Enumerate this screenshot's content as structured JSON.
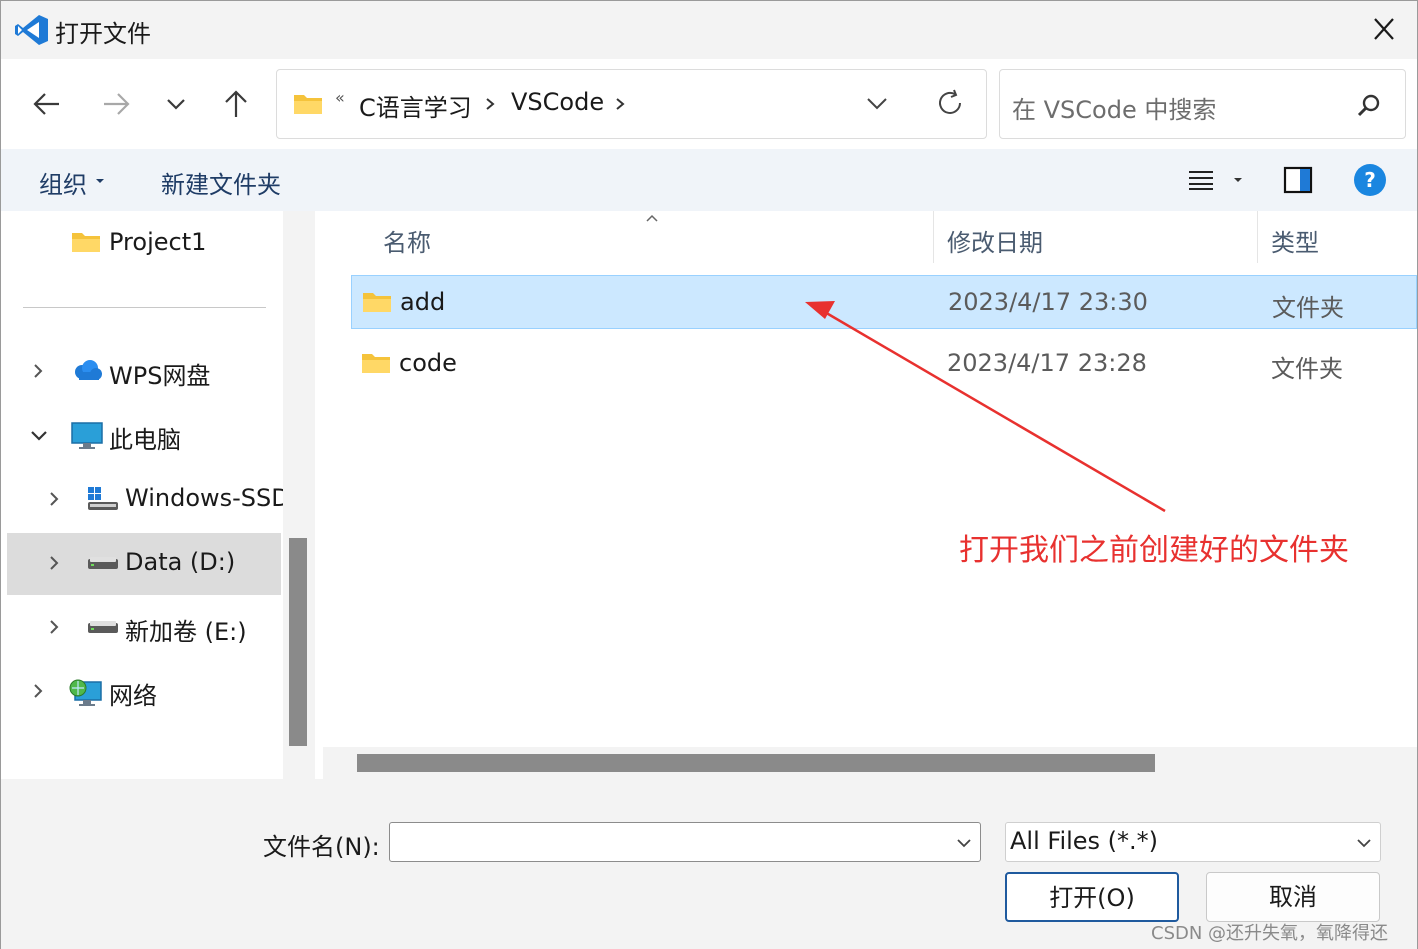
{
  "window": {
    "title": "打开文件"
  },
  "nav": {
    "breadcrumb_overflow": "«",
    "breadcrumbs": [
      "C语言学习",
      "VSCode"
    ],
    "search_placeholder": "在 VSCode 中搜索"
  },
  "toolbar": {
    "organize": "组织",
    "new_folder": "新建文件夹"
  },
  "sidebar": {
    "items": [
      {
        "label": "Project1",
        "icon": "folder-icon"
      },
      {
        "label": "WPS网盘",
        "icon": "cloud-icon"
      },
      {
        "label": "此电脑",
        "icon": "computer-icon"
      },
      {
        "label": "Windows-SSD",
        "icon": "windows-drive-icon"
      },
      {
        "label": "Data (D:)",
        "icon": "drive-icon"
      },
      {
        "label": "新加卷 (E:)",
        "icon": "drive-icon"
      },
      {
        "label": "网络",
        "icon": "network-icon"
      }
    ]
  },
  "file_list": {
    "headers": {
      "name": "名称",
      "date": "修改日期",
      "type": "类型"
    },
    "rows": [
      {
        "name": "add",
        "date": "2023/4/17 23:30",
        "type": "文件夹"
      },
      {
        "name": "code",
        "date": "2023/4/17 23:28",
        "type": "文件夹"
      }
    ]
  },
  "annotation": {
    "text": "打开我们之前创建好的文件夹",
    "color": "#e8312f"
  },
  "bottom": {
    "filename_label": "文件名(N):",
    "filename_value": "",
    "filter_value": "All Files (*.*)",
    "open_button": "打开(O)",
    "cancel_button": "取消"
  },
  "watermark": "CSDN @还升失氧，氧降得还"
}
